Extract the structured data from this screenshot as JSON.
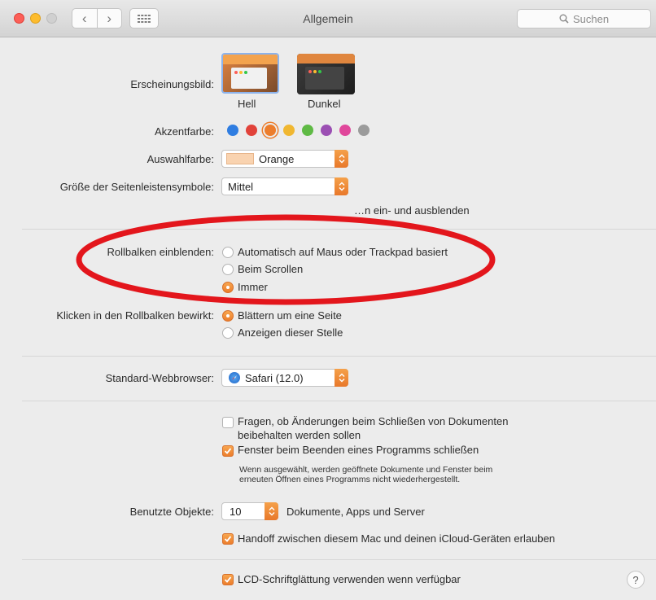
{
  "window": {
    "title": "Allgemein"
  },
  "toolbar": {
    "back": "‹",
    "forward": "›",
    "search_placeholder": "Suchen"
  },
  "appearance": {
    "label": "Erscheinungsbild:",
    "options": [
      {
        "label": "Hell",
        "selected": true
      },
      {
        "label": "Dunkel",
        "selected": false
      }
    ]
  },
  "accent": {
    "label": "Akzentfarbe:",
    "colors": [
      "#2f7de1",
      "#e1423a",
      "#ec7d2c",
      "#f0b731",
      "#5fba45",
      "#9b4fb3",
      "#e0479b",
      "#9b9b9b"
    ],
    "selected_index": 2
  },
  "highlight": {
    "label": "Auswahlfarbe:",
    "value": "Orange",
    "swatch": "#f9d3b0"
  },
  "sidebar_icon_size": {
    "label": "Größe der Seitenleistensymbole:",
    "value": "Mittel"
  },
  "menubar_hidden_text": "…n ein- und ausblenden",
  "scrollbars": {
    "label": "Rollbalken einblenden:",
    "options": [
      {
        "label": "Automatisch auf Maus oder Trackpad basiert",
        "selected": false
      },
      {
        "label": "Beim Scrollen",
        "selected": false
      },
      {
        "label": "Immer",
        "selected": true
      }
    ]
  },
  "scroll_click": {
    "label": "Klicken in den Rollbalken bewirkt:",
    "options": [
      {
        "label": "Blättern um eine Seite",
        "selected": true
      },
      {
        "label": "Anzeigen dieser Stelle",
        "selected": false
      }
    ]
  },
  "browser": {
    "label": "Standard-Webbrowser:",
    "value": "Safari (12.0)"
  },
  "documents": {
    "ask_keep_line1": "Fragen, ob Änderungen beim Schließen von Dokumenten",
    "ask_keep_line2": "beibehalten werden sollen",
    "ask_keep_checked": false,
    "close_windows": "Fenster beim Beenden eines Programms schließen",
    "close_windows_checked": true,
    "note_line1": "Wenn ausgewählt, werden geöffnete Dokumente und Fenster beim",
    "note_line2": "erneuten Öffnen eines Programms nicht wiederhergestellt."
  },
  "recent": {
    "label": "Benutzte Objekte:",
    "value": "10",
    "suffix": "Dokumente, Apps und Server"
  },
  "handoff": {
    "label": "Handoff zwischen diesem Mac und deinen iCloud-Geräten erlauben",
    "checked": true
  },
  "lcd": {
    "label": "LCD-Schriftglättung verwenden wenn verfügbar",
    "checked": true
  },
  "help": "?",
  "colors": {
    "accent": "#ec7d2c",
    "annotation": "#e3161c"
  }
}
